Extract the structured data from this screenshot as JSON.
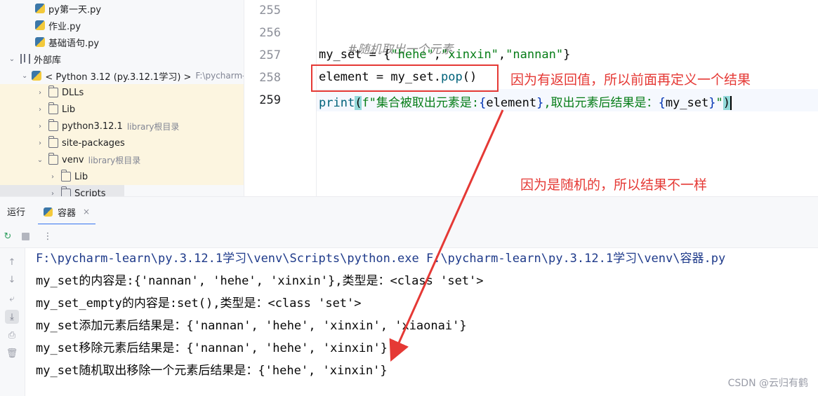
{
  "tree": {
    "items": [
      {
        "label": "py第一天.py",
        "kind": "py"
      },
      {
        "label": "作业.py",
        "kind": "py"
      },
      {
        "label": "基础语句.py",
        "kind": "py"
      },
      {
        "label": "外部库",
        "kind": "lib"
      },
      {
        "label": "< Python 3.12 (py.3.12.1学习) >",
        "hint": "F:\\pycharm-l",
        "kind": "sdk"
      },
      {
        "label": "DLLs",
        "kind": "folder"
      },
      {
        "label": "Lib",
        "kind": "folder"
      },
      {
        "label": "python3.12.1",
        "hint": "library根目录",
        "kind": "folder"
      },
      {
        "label": "site-packages",
        "kind": "folder"
      },
      {
        "label": "venv",
        "hint": "library根目录",
        "kind": "folder"
      },
      {
        "label": "Lib",
        "kind": "folder"
      },
      {
        "label": "Scripts",
        "kind": "folder"
      }
    ]
  },
  "editor": {
    "line_numbers": [
      "255",
      "256",
      "257",
      "258",
      "259"
    ],
    "comment": "#随机取出一个元素",
    "line257": {
      "var": "my_set = {",
      "s1": "\"hehe\"",
      "comma1": ",",
      "s2": "\"xinxin\"",
      "comma2": ",",
      "s3": "\"nannan\"",
      "end": "}"
    },
    "line258": {
      "lhs": "element = my_set.",
      "call": "pop",
      "end": "()"
    },
    "line259": {
      "fn": "print",
      "open": "(",
      "fpre": "f\"集合被取出元素是:",
      "b1": "{",
      "v1": "element",
      "b2": "}",
      "mid": ",取出元素后结果是：",
      "b3": "{",
      "v2": "my_set",
      "b4": "}",
      "fend": "\"",
      "close": ")"
    }
  },
  "annotations": {
    "pop_note": "因为有返回值，所以前面再定义一个结果",
    "random_note": "因为是随机的，所以结果不一样"
  },
  "run": {
    "label": "运行",
    "tab": "容器",
    "close": "×"
  },
  "console": {
    "lines": [
      "F:\\pycharm-learn\\py.3.12.1学习\\venv\\Scripts\\python.exe F:\\pycharm-learn\\py.3.12.1学习\\venv\\容器.py",
      "my_set的内容是:{'nannan', 'hehe', 'xinxin'},类型是：<class 'set'>",
      "my_set_empty的内容是:set(),类型是：<class 'set'>",
      "my_set添加元素后结果是：{'nannan', 'hehe', 'xinxin', 'xiaonai'}",
      "my_set移除元素后结果是：{'nannan', 'hehe', 'xinxin'}",
      "my_set随机取出移除一个元素后结果是：{'hehe', 'xinxin'}"
    ]
  },
  "watermark": "CSDN @云归有鹤",
  "colors": {
    "annotation": "#e53935",
    "accent": "#3574f0"
  }
}
